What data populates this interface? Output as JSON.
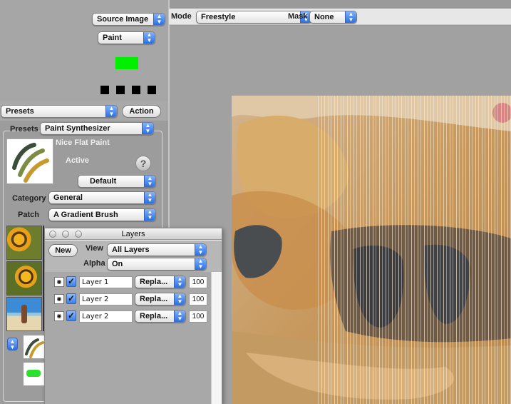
{
  "source": {
    "source_image": "Source Image",
    "paint": "Paint"
  },
  "toolbar": {
    "mode_label": "Mode",
    "mode_value": "Freestyle",
    "mask_label": "Mask",
    "mask_value": "None"
  },
  "colors": {
    "swatch": "#00f000",
    "accent": "#2c6fe0"
  },
  "presets_bar": {
    "presets_select": "Presets",
    "action_button": "Action"
  },
  "presets_panel": {
    "presets_label": "Presets",
    "presets_value": "Paint Synthesizer",
    "preset_name": "Nice Flat Paint",
    "active_label": "Active",
    "help_glyph": "?",
    "default_value": "Default",
    "category_label": "Category",
    "category_value": "General",
    "patch_label": "Patch",
    "patch_value": "A Gradient Brush"
  },
  "layers": {
    "title": "Layers",
    "new_button": "New",
    "view_label": "View",
    "view_value": "All Layers",
    "alpha_label": "Alpha",
    "alpha_value": "On",
    "rows": [
      {
        "name": "Layer 1",
        "mode": "Repla...",
        "opacity": "100"
      },
      {
        "name": "Layer 2",
        "mode": "Repla...",
        "opacity": "100"
      },
      {
        "name": "Layer 2",
        "mode": "Repla...",
        "opacity": "100"
      }
    ]
  },
  "icons": {
    "eye": "eye-icon",
    "check": "checkmark-icon",
    "updown": "updown-arrow-icon"
  }
}
